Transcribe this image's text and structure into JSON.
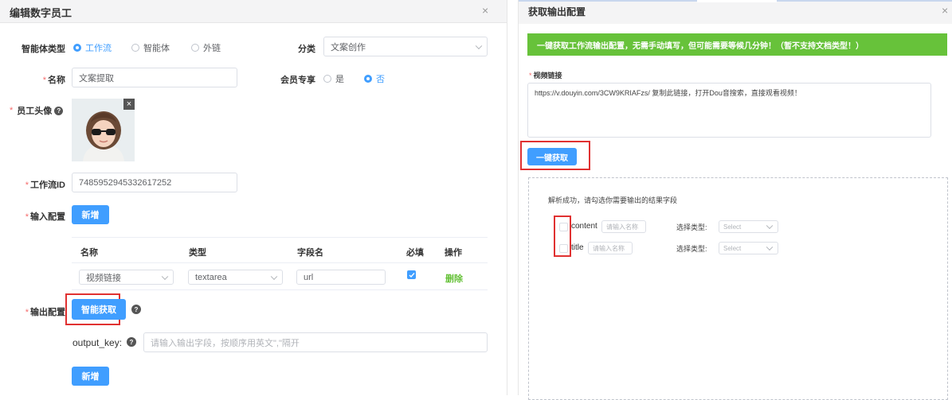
{
  "left_dialog": {
    "title": "编辑数字员工",
    "close": "×",
    "agent_type": {
      "label": "智能体类型",
      "options": [
        "工作流",
        "智能体",
        "外链"
      ],
      "selected": "工作流"
    },
    "category": {
      "label": "分类",
      "value": "文案创作"
    },
    "name": {
      "label": "名称",
      "value": "文案提取"
    },
    "member_only": {
      "label": "会员专享",
      "options": [
        "是",
        "否"
      ],
      "selected": "否"
    },
    "avatar": {
      "label": "员工头像",
      "close": "×"
    },
    "workflow_id": {
      "label": "工作流ID",
      "value": "7485952945332617252"
    },
    "input_config": {
      "label": "输入配置",
      "add_button": "新增",
      "table": {
        "headers": [
          "名称",
          "类型",
          "字段名",
          "必填",
          "操作"
        ],
        "row": {
          "name": "视频链接",
          "type": "textarea",
          "field": "url",
          "required": true,
          "action": "删除"
        }
      }
    },
    "output_config": {
      "label": "输出配置",
      "smart_button": "智能获取",
      "output_key_label": "output_key:",
      "output_key_placeholder": "请输入输出字段，按顺序用英文\",\"隔开",
      "add_button": "新增"
    },
    "help": "?"
  },
  "right_dialog": {
    "title": "获取输出配置",
    "close": "×",
    "banner": "一键获取工作流输出配置，无需手动填写，但可能需要等候几分钟！（暂不支持文档类型！）",
    "video_link": {
      "label": "视频链接",
      "value": "https://v.douyin.com/3CW9KRIAFzs/ 复制此链接，打开Dou音搜索，直接观看视频！"
    },
    "fetch_button": "一键获取",
    "result_text": "解析成功，请勾选你需要输出的结果字段",
    "fields": [
      {
        "name": "content",
        "name_placeholder": "请输入名称",
        "type_label": "选择类型:",
        "type_placeholder": "Select"
      },
      {
        "name": "title",
        "name_placeholder": "请输入名称",
        "type_label": "选择类型:",
        "type_placeholder": "Select"
      }
    ]
  },
  "colors": {
    "primary": "#409eff",
    "success_banner": "#67c23a",
    "required": "#f56c6c",
    "highlight": "#e03131",
    "delete_link": "#67c23a"
  }
}
